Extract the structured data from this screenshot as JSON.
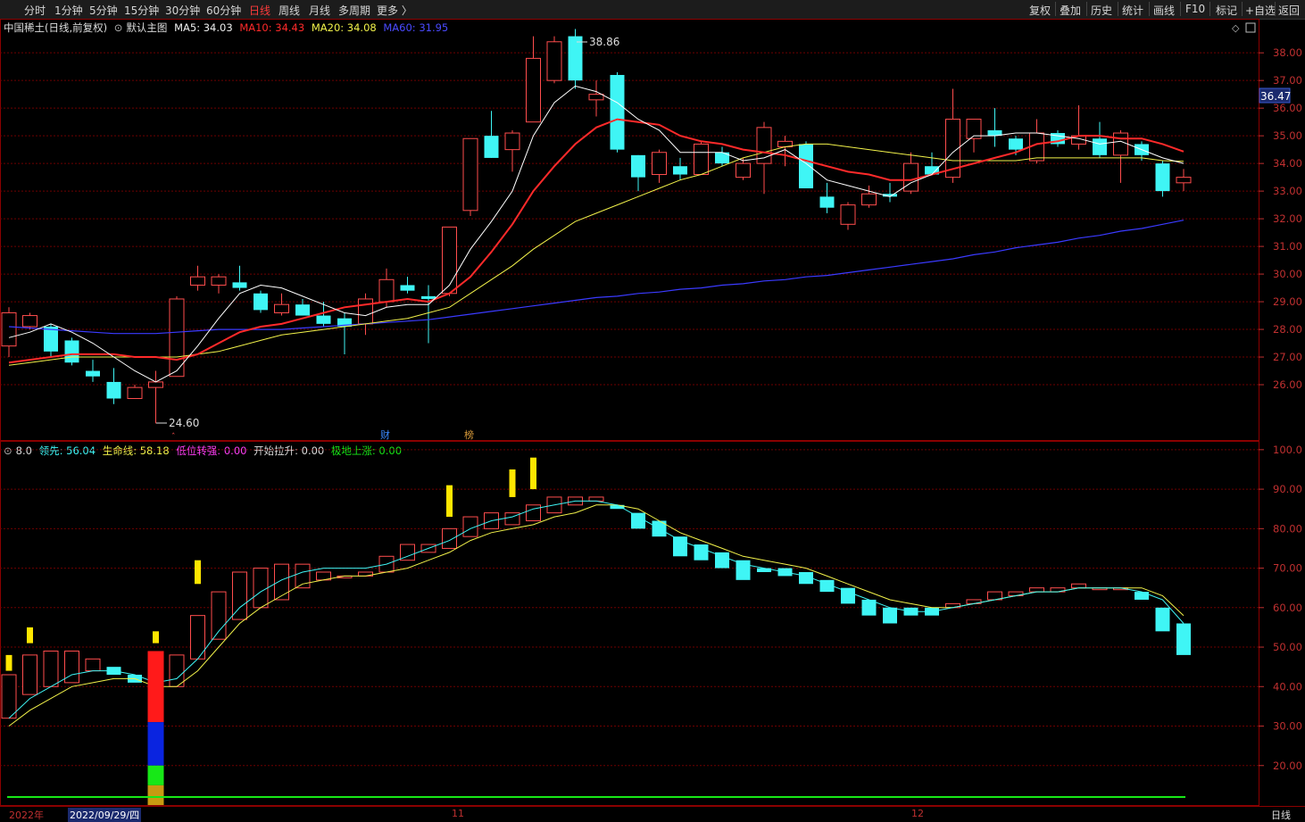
{
  "toolbar": {
    "periods": [
      "分时",
      "1分钟",
      "5分钟",
      "15分钟",
      "30分钟",
      "60分钟",
      "日线",
      "周线",
      "月线",
      "多周期",
      "更多 〉"
    ],
    "active_period": "日线",
    "right_buttons": [
      "复权",
      "叠加",
      "历史",
      "统计",
      "画线",
      "F10",
      "标记",
      "+自选",
      "返回"
    ]
  },
  "main_panel": {
    "stock_name": "中国稀土(日线,前复权)",
    "template": "默认主图",
    "ma5_label": "MA5: 34.03",
    "ma10_label": "MA10: 34.43",
    "ma20_label": "MA20: 34.08",
    "ma60_label": "MA60: 31.95",
    "high_marker": "38.86",
    "low_marker": "24.60",
    "current_price": "36.47",
    "event_cai": "财",
    "event_bang": "榜",
    "axis_ticks": [
      "38.00",
      "37.00",
      "36.00",
      "35.00",
      "34.00",
      "33.00",
      "32.00",
      "31.00",
      "30.00",
      "29.00",
      "28.00",
      "27.00",
      "26.00"
    ]
  },
  "indicator_panel": {
    "value_label": "8.0",
    "lead_label": "领先: 56.04",
    "life_label": "生命线: 58.18",
    "low_turn_label": "低位转强: 0.00",
    "start_pull_label": "开始拉升: 0.00",
    "bottom_rise_label": "极地上涨: 0.00",
    "axis_ticks": [
      "100.0",
      "90.00",
      "80.00",
      "70.00",
      "60.00",
      "50.00",
      "40.00",
      "30.00",
      "20.00"
    ]
  },
  "time_axis": {
    "year_label": "2022年",
    "cursor_date": "2022/09/29/四",
    "month_nov": "11",
    "month_dec": "12",
    "period_label": "日线"
  },
  "colors": {
    "up": "#ff4d4d",
    "down": "#3ff5f5",
    "ma5": "#ffffff",
    "ma10": "#ff2a2a",
    "ma20": "#f2f24a",
    "ma60": "#3a3aff",
    "grid": "#6e0000"
  },
  "chart_data": {
    "type": "candlestick",
    "price_range": [
      24.0,
      39.2
    ],
    "candles": [
      {
        "o": 27.4,
        "c": 28.6,
        "h": 28.8,
        "l": 27.0
      },
      {
        "o": 28.1,
        "c": 28.5,
        "h": 28.6,
        "l": 28.0
      },
      {
        "o": 28.1,
        "c": 27.2,
        "h": 28.2,
        "l": 27.0
      },
      {
        "o": 27.6,
        "c": 26.8,
        "h": 27.7,
        "l": 26.7
      },
      {
        "o": 26.5,
        "c": 26.3,
        "h": 26.9,
        "l": 26.1
      },
      {
        "o": 26.1,
        "c": 25.5,
        "h": 26.6,
        "l": 25.3
      },
      {
        "o": 25.5,
        "c": 25.9,
        "h": 26.0,
        "l": 25.5
      },
      {
        "o": 25.9,
        "c": 26.1,
        "h": 26.5,
        "l": 24.6
      },
      {
        "o": 26.3,
        "c": 29.1,
        "h": 29.2,
        "l": 26.3
      },
      {
        "o": 29.6,
        "c": 29.9,
        "h": 30.3,
        "l": 29.4
      },
      {
        "o": 29.6,
        "c": 29.9,
        "h": 30.0,
        "l": 29.3
      },
      {
        "o": 29.7,
        "c": 29.5,
        "h": 30.3,
        "l": 29.4
      },
      {
        "o": 29.3,
        "c": 28.7,
        "h": 29.4,
        "l": 28.6
      },
      {
        "o": 28.6,
        "c": 28.9,
        "h": 29.3,
        "l": 28.5
      },
      {
        "o": 28.9,
        "c": 28.5,
        "h": 29.1,
        "l": 28.5
      },
      {
        "o": 28.5,
        "c": 28.2,
        "h": 29.0,
        "l": 28.1
      },
      {
        "o": 28.4,
        "c": 28.1,
        "h": 28.6,
        "l": 27.1
      },
      {
        "o": 28.2,
        "c": 29.1,
        "h": 29.3,
        "l": 27.8
      },
      {
        "o": 29.0,
        "c": 29.8,
        "h": 30.2,
        "l": 28.8
      },
      {
        "o": 29.6,
        "c": 29.4,
        "h": 29.9,
        "l": 29.3
      },
      {
        "o": 29.2,
        "c": 29.1,
        "h": 29.6,
        "l": 27.5
      },
      {
        "o": 29.3,
        "c": 31.7,
        "h": 31.7,
        "l": 29.2
      },
      {
        "o": 32.3,
        "c": 34.9,
        "h": 34.9,
        "l": 32.1
      },
      {
        "o": 35.0,
        "c": 34.2,
        "h": 35.9,
        "l": 34.2
      },
      {
        "o": 34.5,
        "c": 35.1,
        "h": 35.2,
        "l": 33.7
      },
      {
        "o": 35.5,
        "c": 37.8,
        "h": 38.6,
        "l": 35.5
      },
      {
        "o": 37.0,
        "c": 38.4,
        "h": 38.6,
        "l": 36.9
      },
      {
        "o": 38.6,
        "c": 37.0,
        "h": 38.86,
        "l": 36.7
      },
      {
        "o": 36.3,
        "c": 36.5,
        "h": 37.0,
        "l": 35.7
      },
      {
        "o": 37.2,
        "c": 34.5,
        "h": 37.3,
        "l": 34.4
      },
      {
        "o": 34.3,
        "c": 33.5,
        "h": 34.3,
        "l": 33.0
      },
      {
        "o": 33.6,
        "c": 34.4,
        "h": 34.5,
        "l": 33.3
      },
      {
        "o": 33.9,
        "c": 33.6,
        "h": 34.2,
        "l": 33.4
      },
      {
        "o": 33.6,
        "c": 34.7,
        "h": 34.8,
        "l": 33.6
      },
      {
        "o": 34.4,
        "c": 34.0,
        "h": 34.6,
        "l": 33.9
      },
      {
        "o": 33.5,
        "c": 34.0,
        "h": 34.2,
        "l": 33.4
      },
      {
        "o": 34.0,
        "c": 35.3,
        "h": 35.5,
        "l": 32.9
      },
      {
        "o": 34.6,
        "c": 34.8,
        "h": 35.0,
        "l": 33.9
      },
      {
        "o": 34.7,
        "c": 33.1,
        "h": 34.8,
        "l": 33.1
      },
      {
        "o": 32.8,
        "c": 32.4,
        "h": 33.3,
        "l": 32.2
      },
      {
        "o": 31.8,
        "c": 32.5,
        "h": 32.6,
        "l": 31.6
      },
      {
        "o": 32.5,
        "c": 32.9,
        "h": 33.2,
        "l": 32.4
      },
      {
        "o": 32.9,
        "c": 32.8,
        "h": 33.3,
        "l": 32.6
      },
      {
        "o": 33.0,
        "c": 34.0,
        "h": 34.4,
        "l": 32.9
      },
      {
        "o": 33.9,
        "c": 33.6,
        "h": 34.4,
        "l": 33.6
      },
      {
        "o": 33.5,
        "c": 35.6,
        "h": 36.7,
        "l": 33.3
      },
      {
        "o": 34.9,
        "c": 35.6,
        "h": 35.6,
        "l": 34.4
      },
      {
        "o": 35.2,
        "c": 35.0,
        "h": 36.0,
        "l": 34.6
      },
      {
        "o": 34.9,
        "c": 34.5,
        "h": 35.0,
        "l": 34.3
      },
      {
        "o": 34.1,
        "c": 35.1,
        "h": 35.6,
        "l": 34.0
      },
      {
        "o": 35.1,
        "c": 34.7,
        "h": 35.2,
        "l": 34.6
      },
      {
        "o": 34.7,
        "c": 35.0,
        "h": 36.1,
        "l": 34.5
      },
      {
        "o": 34.9,
        "c": 34.3,
        "h": 35.5,
        "l": 34.2
      },
      {
        "o": 34.3,
        "c": 35.1,
        "h": 35.2,
        "l": 33.3
      },
      {
        "o": 34.7,
        "c": 34.3,
        "h": 34.8,
        "l": 34.1
      },
      {
        "o": 34.0,
        "c": 33.0,
        "h": 34.1,
        "l": 32.8
      },
      {
        "o": 33.3,
        "c": 33.5,
        "h": 33.8,
        "l": 33.0
      }
    ],
    "ma5": [
      27.7,
      27.9,
      28.2,
      27.9,
      27.5,
      27.0,
      26.5,
      26.1,
      26.5,
      27.4,
      28.4,
      29.3,
      29.6,
      29.5,
      29.2,
      28.9,
      28.6,
      28.5,
      28.8,
      28.9,
      28.9,
      29.6,
      30.9,
      31.9,
      33.0,
      35.0,
      36.2,
      36.8,
      36.6,
      36.2,
      35.6,
      35.2,
      34.4,
      34.4,
      34.4,
      34.1,
      34.2,
      34.5,
      34.0,
      33.4,
      33.2,
      33.0,
      32.8,
      33.3,
      33.6,
      34.4,
      35.0,
      35.0,
      35.1,
      35.1,
      35.0,
      34.9,
      34.7,
      34.8,
      34.5,
      34.2,
      34.0
    ],
    "ma10": [
      26.8,
      26.9,
      27.0,
      27.1,
      27.1,
      27.1,
      27.0,
      27.0,
      26.9,
      27.1,
      27.5,
      27.9,
      28.1,
      28.2,
      28.4,
      28.6,
      28.8,
      28.9,
      29.0,
      29.1,
      29.0,
      29.3,
      29.9,
      30.8,
      31.8,
      33.0,
      33.9,
      34.7,
      35.3,
      35.6,
      35.5,
      35.4,
      35.0,
      34.8,
      34.7,
      34.5,
      34.4,
      34.3,
      34.1,
      33.9,
      33.7,
      33.6,
      33.4,
      33.4,
      33.6,
      33.8,
      34.0,
      34.2,
      34.4,
      34.7,
      34.8,
      35.0,
      35.0,
      34.9,
      34.9,
      34.7,
      34.43
    ],
    "ma20": [
      26.7,
      26.8,
      26.9,
      27.0,
      27.0,
      27.0,
      27.0,
      27.0,
      27.0,
      27.1,
      27.2,
      27.4,
      27.6,
      27.8,
      27.9,
      28.0,
      28.1,
      28.2,
      28.3,
      28.4,
      28.6,
      28.8,
      29.3,
      29.8,
      30.3,
      30.9,
      31.4,
      31.9,
      32.2,
      32.5,
      32.8,
      33.1,
      33.4,
      33.6,
      33.9,
      34.2,
      34.4,
      34.6,
      34.7,
      34.7,
      34.6,
      34.5,
      34.4,
      34.3,
      34.2,
      34.1,
      34.1,
      34.1,
      34.1,
      34.2,
      34.2,
      34.2,
      34.2,
      34.2,
      34.2,
      34.1,
      34.08
    ],
    "ma60": [
      28.1,
      28.05,
      28.0,
      27.95,
      27.9,
      27.85,
      27.85,
      27.85,
      27.9,
      27.95,
      28.0,
      28.0,
      28.0,
      28.0,
      28.05,
      28.1,
      28.15,
      28.2,
      28.25,
      28.3,
      28.35,
      28.45,
      28.55,
      28.65,
      28.75,
      28.85,
      28.95,
      29.05,
      29.15,
      29.2,
      29.3,
      29.35,
      29.45,
      29.5,
      29.6,
      29.65,
      29.75,
      29.8,
      29.9,
      29.95,
      30.05,
      30.15,
      30.25,
      30.35,
      30.45,
      30.55,
      30.7,
      30.8,
      30.95,
      31.05,
      31.15,
      31.3,
      31.4,
      31.55,
      31.65,
      31.8,
      31.95
    ],
    "indicator_range": [
      10,
      102
    ],
    "indicator_bars": [
      {
        "o": 32,
        "c": 43
      },
      {
        "o": 38,
        "c": 48
      },
      {
        "o": 40,
        "c": 49
      },
      {
        "o": 41,
        "c": 49
      },
      {
        "o": 44,
        "c": 47
      },
      {
        "o": 45,
        "c": 43
      },
      {
        "o": 43,
        "c": 41
      },
      {
        "o": 41,
        "c": 39
      },
      {
        "o": 40,
        "c": 48
      },
      {
        "o": 47,
        "c": 58
      },
      {
        "o": 52,
        "c": 64
      },
      {
        "o": 57,
        "c": 69
      },
      {
        "o": 60,
        "c": 70
      },
      {
        "o": 62,
        "c": 71
      },
      {
        "o": 65,
        "c": 71
      },
      {
        "o": 67,
        "c": 69
      },
      {
        "o": 68,
        "c": 68
      },
      {
        "o": 68,
        "c": 69
      },
      {
        "o": 69,
        "c": 73
      },
      {
        "o": 72,
        "c": 76
      },
      {
        "o": 74,
        "c": 76
      },
      {
        "o": 75,
        "c": 80
      },
      {
        "o": 78,
        "c": 83
      },
      {
        "o": 80,
        "c": 84
      },
      {
        "o": 81,
        "c": 84
      },
      {
        "o": 82,
        "c": 86
      },
      {
        "o": 84,
        "c": 88
      },
      {
        "o": 86,
        "c": 88
      },
      {
        "o": 87,
        "c": 88
      },
      {
        "o": 86,
        "c": 85
      },
      {
        "o": 84,
        "c": 80
      },
      {
        "o": 82,
        "c": 78
      },
      {
        "o": 78,
        "c": 73
      },
      {
        "o": 76,
        "c": 72
      },
      {
        "o": 74,
        "c": 70
      },
      {
        "o": 72,
        "c": 67
      },
      {
        "o": 70,
        "c": 69
      },
      {
        "o": 70,
        "c": 68
      },
      {
        "o": 69,
        "c": 66
      },
      {
        "o": 67,
        "c": 64
      },
      {
        "o": 65,
        "c": 61
      },
      {
        "o": 62,
        "c": 58
      },
      {
        "o": 60,
        "c": 56
      },
      {
        "o": 60,
        "c": 58
      },
      {
        "o": 60,
        "c": 58
      },
      {
        "o": 60,
        "c": 61
      },
      {
        "o": 61,
        "c": 62
      },
      {
        "o": 62,
        "c": 64
      },
      {
        "o": 63,
        "c": 64
      },
      {
        "o": 64,
        "c": 65
      },
      {
        "o": 64,
        "c": 65
      },
      {
        "o": 65,
        "c": 66
      },
      {
        "o": 65,
        "c": 65
      },
      {
        "o": 65,
        "c": 65
      },
      {
        "o": 64,
        "c": 62
      },
      {
        "o": 60,
        "c": 54
      },
      {
        "o": 56,
        "c": 48
      }
    ],
    "lead_line": [
      32,
      37,
      40,
      43,
      44,
      44,
      43,
      41,
      42,
      47,
      54,
      60,
      64,
      67,
      69,
      70,
      70,
      70,
      71,
      73,
      75,
      77,
      80,
      82,
      83,
      85,
      86,
      87,
      87,
      86,
      83,
      80,
      77,
      75,
      73,
      71,
      70,
      69,
      68,
      66,
      64,
      62,
      60,
      59,
      59,
      60,
      61,
      62,
      63,
      64,
      64,
      65,
      65,
      65,
      64,
      62,
      56
    ],
    "life_line": [
      30,
      34,
      37,
      40,
      41,
      42,
      42,
      40,
      40,
      44,
      50,
      56,
      60,
      63,
      66,
      67,
      68,
      68,
      69,
      70,
      72,
      74,
      77,
      79,
      80,
      81,
      83,
      84,
      86,
      86,
      85,
      82,
      79,
      77,
      75,
      73,
      72,
      71,
      70,
      68,
      66,
      64,
      62,
      61,
      60,
      60,
      61,
      62,
      63,
      64,
      64,
      65,
      65,
      65,
      65,
      63,
      58
    ],
    "yellow_signals": [
      {
        "i": 0,
        "lo": 44,
        "hi": 48
      },
      {
        "i": 1,
        "lo": 51,
        "hi": 55
      },
      {
        "i": 7,
        "lo": 51,
        "hi": 54
      },
      {
        "i": 9,
        "lo": 66,
        "hi": 72
      },
      {
        "i": 21,
        "lo": 83,
        "hi": 91
      },
      {
        "i": 24,
        "lo": 88,
        "hi": 95
      },
      {
        "i": 25,
        "lo": 90,
        "hi": 98
      }
    ],
    "signal_stack": {
      "i": 7,
      "segments": [
        {
          "color": "#ff1a1a",
          "lo": 31,
          "hi": 49
        },
        {
          "color": "#0a24e0",
          "lo": 20,
          "hi": 31
        },
        {
          "color": "#17e817",
          "lo": 15,
          "hi": 20
        },
        {
          "color": "#c99a12",
          "lo": 10,
          "hi": 15
        }
      ]
    }
  }
}
